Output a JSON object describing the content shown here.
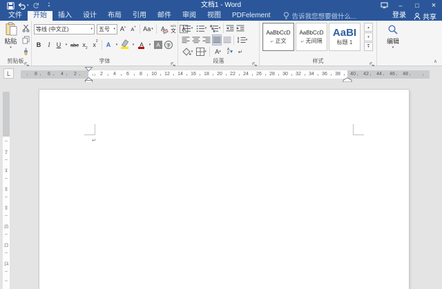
{
  "icons": {
    "caret": "▾",
    "up": "▴",
    "down": "▾",
    "minimize": "–",
    "maximize": "□",
    "close": "×",
    "collapse": "∧",
    "grow_mark": "▴",
    "shrink_mark": "▾",
    "marks": "↵",
    "pilcrow": "↵"
  },
  "titlebar": {
    "title": "文档1 - Word"
  },
  "tabs": {
    "file": "文件",
    "items": [
      "开始",
      "插入",
      "设计",
      "布局",
      "引用",
      "邮件",
      "审阅",
      "视图",
      "PDFelement"
    ],
    "tell_me": "告诉我您想要做什么...",
    "sign_in": "登录",
    "share": "共享"
  },
  "ribbon": {
    "clipboard": {
      "label": "剪贴板",
      "paste": "粘贴"
    },
    "font": {
      "label": "字体",
      "name": "等线 (中文正)",
      "size": "五号",
      "grow": "A",
      "shrink": "A",
      "change_case": "Aa",
      "clear": "A",
      "phonetic_top": "wén",
      "phonetic": "文",
      "char_border": "A",
      "bold": "B",
      "italic": "I",
      "underline": "U",
      "strike": "abc",
      "sub_base": "x",
      "sub_script": "2",
      "sup_base": "x",
      "sup_script": "2",
      "effects": "A",
      "color": "A",
      "shade": "A",
      "circle": "字"
    },
    "paragraph": {
      "label": "段落",
      "asian": "A",
      "sort_a": "A",
      "sort_z": "Z"
    },
    "styles": {
      "label": "样式",
      "marker": "↵",
      "items": [
        {
          "preview": "AaBbCcD",
          "name": "正文"
        },
        {
          "preview": "AaBbCcD",
          "name": "无间隔"
        },
        {
          "preview": "AaBI",
          "name": "标题 1"
        }
      ]
    },
    "editing": {
      "label": "编辑"
    }
  },
  "ruler": {
    "tab_selector": "L",
    "left": [
      "8",
      "6",
      "4",
      "2"
    ],
    "mid": [
      "2",
      "4",
      "6",
      "8",
      "10",
      "12",
      "14",
      "16",
      "18",
      "20",
      "22",
      "24",
      "26",
      "28",
      "30",
      "32",
      "34",
      "36",
      "38"
    ],
    "right": [
      "40",
      "42",
      "44",
      "46",
      "48"
    ],
    "vertical": [
      "2",
      "4",
      "6",
      "8",
      "10",
      "12",
      "14"
    ]
  }
}
